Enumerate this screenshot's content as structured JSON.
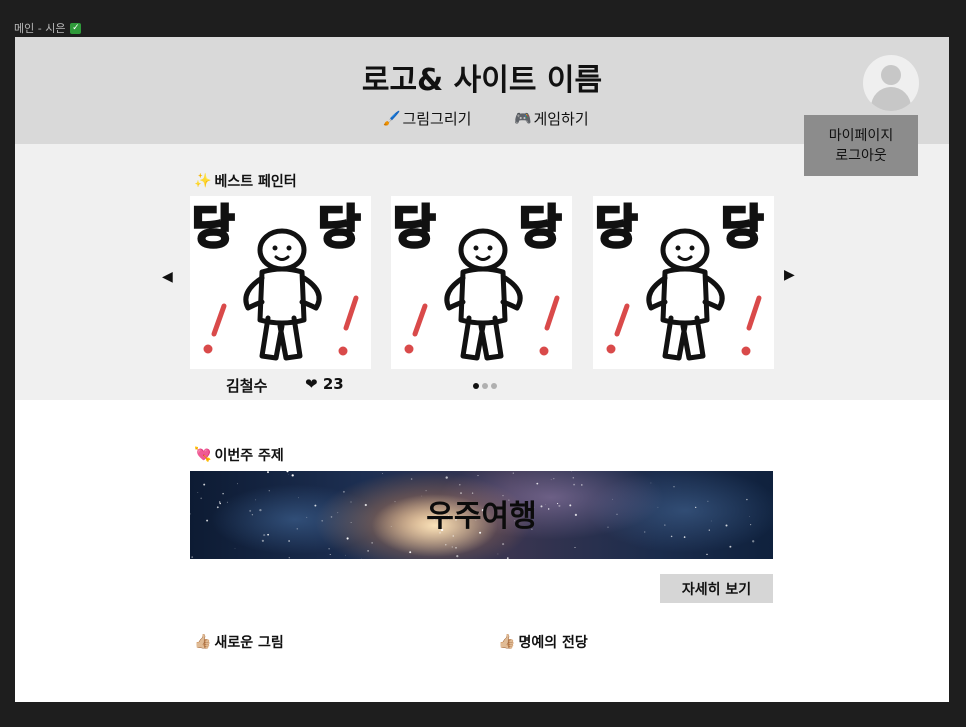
{
  "frame": {
    "label": "메인 - 시은",
    "check_icon": "check-icon"
  },
  "header": {
    "title": "로고& 사이트 이름",
    "nav": [
      {
        "icon": "paintbrush-icon",
        "label": "그림그리기"
      },
      {
        "icon": "gamepad-icon",
        "label": "게임하기"
      }
    ],
    "user_menu": {
      "mypage": "마이페이지",
      "logout": "로그아웃"
    }
  },
  "best": {
    "title_icon": "sparkles-icon",
    "title": "베스트 페인터",
    "cards": [
      {
        "text_left": "당",
        "text_right": "당"
      },
      {
        "text_left": "당",
        "text_right": "당"
      },
      {
        "text_left": "당",
        "text_right": "당"
      }
    ],
    "first_artist": {
      "name": "김철수",
      "likes": "23"
    },
    "page_count": 3,
    "active_page": 1
  },
  "theme": {
    "title_icon": "heart-arrow-icon",
    "title": "이번주 주제",
    "banner_text": "우주여행",
    "more_button": "자세히 보기"
  },
  "new_drawings": {
    "title_icon": "thumbs-up-icon",
    "title": "새로운 그림"
  },
  "hall_of_fame": {
    "title_icon": "thumbs-up-icon",
    "title": "명예의 전당"
  },
  "colors": {
    "header_bg": "#d9d9d9",
    "section_bg": "#f0f0f0",
    "user_menu_bg": "#8c8c8c",
    "button_bg": "#d6d6d6",
    "drawing_accent": "#d94a4a"
  }
}
